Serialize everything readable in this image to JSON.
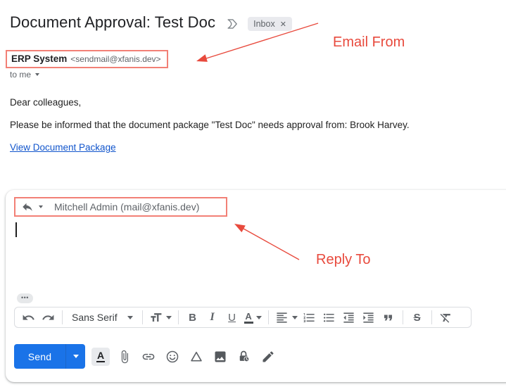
{
  "header": {
    "subject": "Document Approval: Test Doc",
    "label": "Inbox",
    "label_close": "✕"
  },
  "sender": {
    "name": "ERP System",
    "email": "<sendmail@xfanis.dev>",
    "to_line": "to me"
  },
  "body": {
    "greeting": "Dear colleagues,",
    "message": "Please be informed that the document package \"Test Doc\" needs approval from: Brook Harvey.",
    "link_label": "View Document Package"
  },
  "annotations": {
    "email_from_label": "Email From",
    "reply_to_label": "Reply To",
    "arrow_color": "#e84a3d",
    "highlight_box_color": "#f28076"
  },
  "compose": {
    "reply_recipient": "Mitchell Admin (mail@xfanis.dev)",
    "trimmed_dots": "•••",
    "toolbar": {
      "font_name": "Sans Serif",
      "bold_label": "B",
      "italic_label": "I",
      "underline_label": "U",
      "text_color_label": "A",
      "strikethrough_label": "S"
    },
    "send_label": "Send",
    "formatting_toggle_label": "A"
  },
  "icons": {
    "importance_marker": "gmail-importance-chevron",
    "chip_close": "✕",
    "dropdown_caret": "▾",
    "reply_arrow": "curved-left-arrow",
    "trimmed_content": "•••"
  },
  "colors": {
    "send_button": "#1a73e8",
    "link": "#1155cc",
    "chip_bg": "#e9eaee",
    "icon_gray": "#5f6368",
    "title_text": "#202124"
  }
}
